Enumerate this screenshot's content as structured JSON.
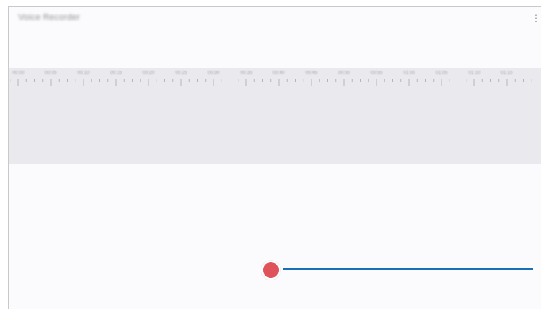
{
  "app": {
    "title": "Voice Recorder",
    "menu_icon": "more-vertical-icon"
  },
  "timeline": {
    "tick_labels": [
      "00:00",
      "00:05",
      "00:10",
      "00:15",
      "00:20",
      "00:25",
      "00:30",
      "00:35",
      "00:40",
      "00:45",
      "00:50",
      "00:55",
      "01:00",
      "01:05",
      "01:10",
      "01:15"
    ]
  },
  "recorder": {
    "record_icon": "record-icon",
    "accent_color": "#1a6fb5",
    "record_color": "#e0525a"
  }
}
